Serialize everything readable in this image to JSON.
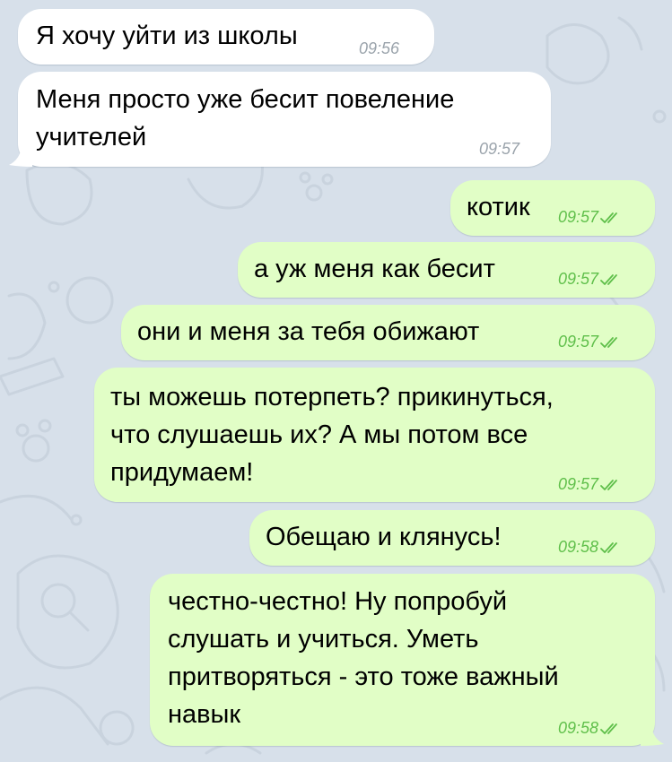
{
  "colors": {
    "background": "#d7e0ea",
    "incoming_bubble": "#ffffff",
    "outgoing_bubble": "#e1fec6",
    "incoming_time": "#9aa3ab",
    "outgoing_time": "#5fbf4a",
    "read_check": "#5fbf4a"
  },
  "messages": [
    {
      "direction": "in",
      "text": "Я хочу уйти из школы",
      "time": "09:56"
    },
    {
      "direction": "in",
      "text": "Меня просто уже бесит повеление\nучителей",
      "time": "09:57"
    },
    {
      "direction": "out",
      "text": "котик",
      "time": "09:57",
      "status_icon": "double-check-icon"
    },
    {
      "direction": "out",
      "text": "а уж меня как бесит",
      "time": "09:57",
      "status_icon": "double-check-icon"
    },
    {
      "direction": "out",
      "text": "они и меня за тебя обижают",
      "time": "09:57",
      "status_icon": "double-check-icon"
    },
    {
      "direction": "out",
      "text": "ты можешь потерпеть? прикинуться,\nчто слушаешь их? А мы потом все\nпридумаем!",
      "time": "09:57",
      "status_icon": "double-check-icon"
    },
    {
      "direction": "out",
      "text": "Обещаю и клянусь!",
      "time": "09:58",
      "status_icon": "double-check-icon"
    },
    {
      "direction": "out",
      "text": "честно-честно! Ну попробуй\nслушать и учиться. Уметь\nпритворяться - это тоже важный\nнавык",
      "time": "09:58",
      "status_icon": "double-check-icon"
    }
  ]
}
